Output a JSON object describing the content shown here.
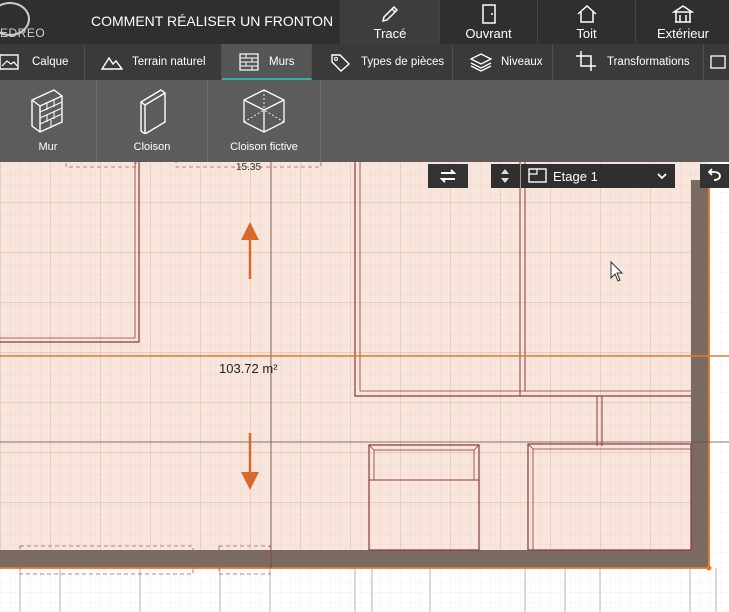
{
  "app": {
    "logo_text": "EDREO",
    "title": "COMMENT RÉALISER UN FRONTON"
  },
  "modes": [
    {
      "label": "Tracé",
      "icon": "pencil-icon",
      "active": true
    },
    {
      "label": "Ouvrant",
      "icon": "door-icon",
      "active": false
    },
    {
      "label": "Toit",
      "icon": "roof-icon",
      "active": false
    },
    {
      "label": "Extérieur",
      "icon": "gazebo-icon",
      "active": false
    }
  ],
  "tools": [
    {
      "label": "Calque",
      "icon": "layer-image-icon"
    },
    {
      "label": "Terrain naturel",
      "icon": "mountain-icon"
    },
    {
      "label": "Murs",
      "icon": "brick-wall-icon",
      "active": true
    },
    {
      "label": "Types de pièces",
      "icon": "tag-icon"
    },
    {
      "label": "Niveaux",
      "icon": "stacked-layers-icon"
    },
    {
      "label": "Transformations",
      "icon": "crop-icon"
    }
  ],
  "wall_tools": [
    {
      "label": "Mur",
      "icon": "brick-wall-icon"
    },
    {
      "label": "Cloison",
      "icon": "partition-panel-icon"
    },
    {
      "label": "Cloison fictive",
      "icon": "wireframe-cube-icon"
    }
  ],
  "canvas": {
    "dimension_label": "15.35",
    "area_label": "103.72 m²",
    "level_select": "Etage 1",
    "colors": {
      "background": "#f8e6dc",
      "wall": "#7a6a62",
      "outline": "#8b3a3a",
      "accent": "#e07a2e"
    }
  }
}
